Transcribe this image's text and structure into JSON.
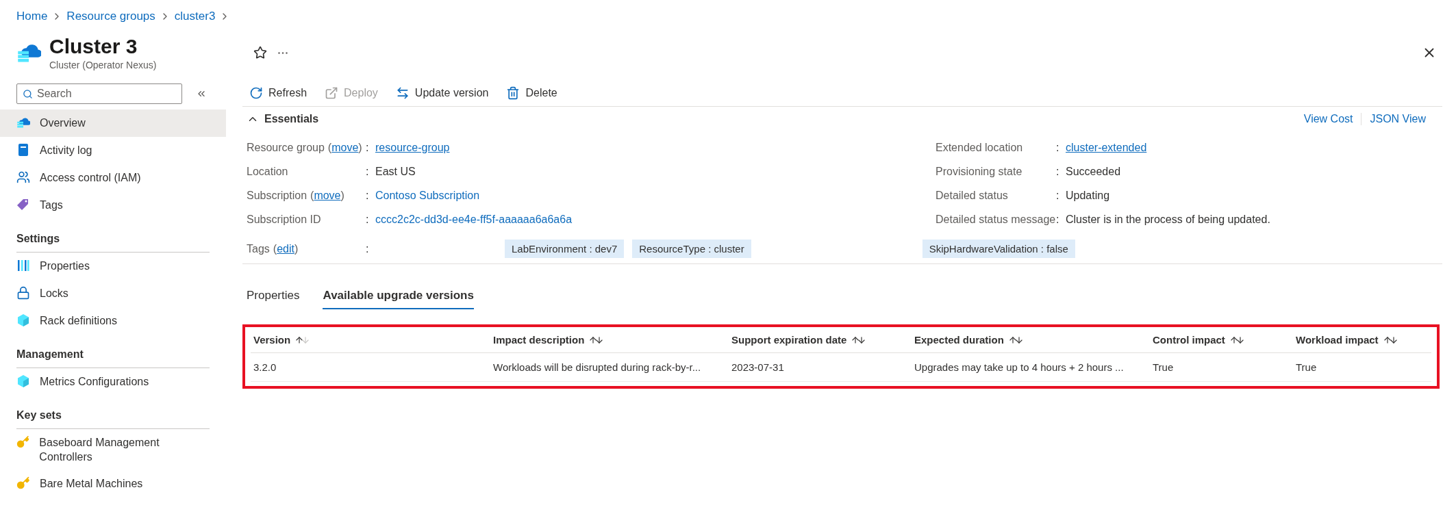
{
  "breadcrumb": [
    "Home",
    "Resource groups",
    "cluster3"
  ],
  "header": {
    "title": "Cluster 3",
    "subtitle": "Cluster (Operator Nexus)"
  },
  "sidebar": {
    "search": {
      "placeholder": "Search"
    },
    "sections": [
      {
        "items": [
          {
            "label": "Overview",
            "selected": true
          },
          {
            "label": "Activity log",
            "selected": false
          },
          {
            "label": "Access control (IAM)",
            "selected": false
          },
          {
            "label": "Tags",
            "selected": false
          }
        ]
      },
      {
        "heading": "Settings",
        "items": [
          {
            "label": "Properties",
            "selected": false
          },
          {
            "label": "Locks",
            "selected": false
          },
          {
            "label": "Rack definitions",
            "selected": false
          }
        ]
      },
      {
        "heading": "Management",
        "items": [
          {
            "label": "Metrics Configurations",
            "selected": false
          }
        ]
      },
      {
        "heading": "Key sets",
        "items": [
          {
            "label": "Baseboard Management Controllers",
            "selected": false
          },
          {
            "label": "Bare Metal Machines",
            "selected": false
          }
        ]
      }
    ]
  },
  "toolbar": [
    {
      "label": "Refresh",
      "disabled": false
    },
    {
      "label": "Deploy",
      "disabled": true
    },
    {
      "label": "Update version",
      "disabled": false
    },
    {
      "label": "Delete",
      "disabled": false
    }
  ],
  "essentials": {
    "title": "Essentials",
    "links": [
      "View Cost",
      "JSON View"
    ],
    "left": [
      {
        "label": "Resource group",
        "open": "(",
        "action": "move",
        "close": ")",
        "colon": ":",
        "value": "resource-group",
        "kind": "underlined"
      },
      {
        "label": "Location",
        "colon": ":",
        "value": "East US",
        "kind": "plain"
      },
      {
        "label": "Subscription",
        "open": "(",
        "action": "move",
        "close": ")",
        "colon": ":",
        "value": "Contoso Subscription",
        "kind": "link"
      },
      {
        "label": "Subscription ID",
        "colon": ":",
        "value": "cccc2c2c-dd3d-ee4e-ff5f-aaaaaa6a6a6a",
        "kind": "link"
      }
    ],
    "right": [
      {
        "label": "Extended location",
        "colon": ":",
        "value": "cluster-extended",
        "kind": "underlined"
      },
      {
        "label": "Provisioning state",
        "colon": ":",
        "value": "Succeeded",
        "kind": "plain"
      },
      {
        "label": "Detailed status",
        "colon": ":",
        "value": "Updating",
        "kind": "plain"
      },
      {
        "label": "Detailed status message",
        "colon": ":",
        "value": "Cluster is in the process of being updated.",
        "kind": "plain"
      }
    ],
    "tags": {
      "label": "Tags",
      "open": "(",
      "action": "edit",
      "close": ")",
      "colon": ":",
      "items": [
        "LabEnvironment : dev7",
        "ResourceType : cluster",
        "SkipHardwareValidation : false"
      ]
    }
  },
  "tabs": [
    {
      "label": "Properties",
      "selected": false
    },
    {
      "label": "Available upgrade versions",
      "selected": true
    }
  ],
  "table": {
    "highlighted": true,
    "columns": [
      {
        "label": "Version",
        "sorted": true
      },
      {
        "label": "Impact description",
        "sorted": false
      },
      {
        "label": "Support expiration date",
        "sorted": false
      },
      {
        "label": "Expected duration",
        "sorted": false
      },
      {
        "label": "Control impact",
        "sorted": false
      },
      {
        "label": "Workload impact",
        "sorted": false
      }
    ],
    "rows": [
      [
        "3.2.0",
        "Workloads will be disrupted during rack-by-r...",
        "2023-07-31",
        "Upgrades may take up to 4 hours + 2 hours ...",
        "True",
        "True"
      ]
    ]
  }
}
